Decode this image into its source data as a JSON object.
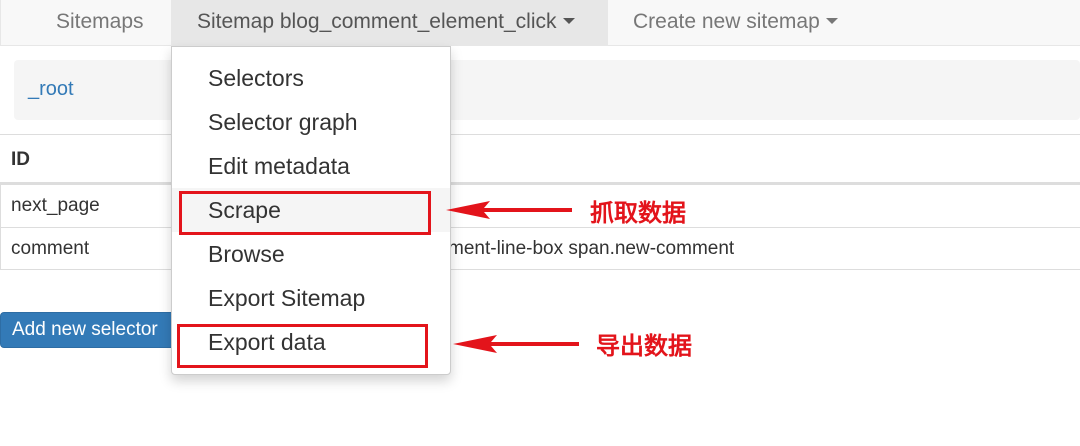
{
  "navbar": {
    "sitemaps_label": "Sitemaps",
    "current_sitemap_label": "Sitemap blog_comment_element_click",
    "create_label": "Create new sitemap"
  },
  "breadcrumb": {
    "root_label": "_root"
  },
  "table": {
    "header": {
      "id": "ID"
    },
    "rows": [
      {
        "id": "next_page",
        "selector": ""
      },
      {
        "id": "comment",
        "selector": "ment-line-box span.new-comment"
      }
    ]
  },
  "add_selector_label": "Add new selector",
  "dropdown": {
    "items": [
      {
        "label": "Selectors"
      },
      {
        "label": "Selector graph"
      },
      {
        "label": "Edit metadata"
      },
      {
        "label": "Scrape"
      },
      {
        "label": "Browse"
      },
      {
        "label": "Export Sitemap"
      },
      {
        "label": "Export data"
      }
    ]
  },
  "annotations": {
    "scrape_note": "抓取数据",
    "export_note": "导出数据",
    "color": "#e3141b"
  },
  "colors": {
    "primary": "#337ab7",
    "navbar_bg": "#f8f8f8",
    "active_tab_bg": "#e7e7e7"
  }
}
